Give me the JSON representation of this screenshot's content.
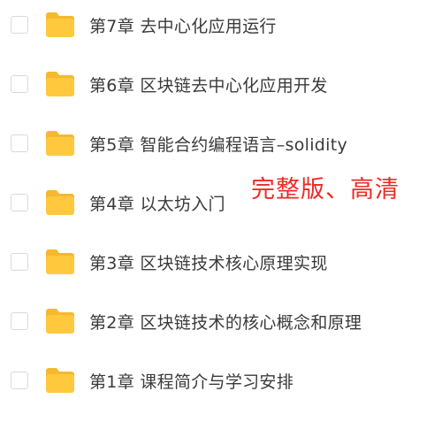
{
  "items": [
    {
      "label": "第7章  去中心化应用运行"
    },
    {
      "label": "第6章  区块链去中心化应用开发"
    },
    {
      "label": "第5章  智能合约编程语言–solidity"
    },
    {
      "label": "第4章  以太坊入门"
    },
    {
      "label": "第3章  区块链技术核心原理实现"
    },
    {
      "label": "第2章  区块链技术的核心概念和原理"
    },
    {
      "label": "第1章  课程简介与学习安排"
    }
  ],
  "overlay": {
    "text": "完整版、高清"
  },
  "colors": {
    "folder": "#FFC83D",
    "folder_tab": "#F5B82E",
    "overlay": "#EE2A24",
    "text": "#3A3A3A",
    "checkbox_border": "#D9D9D9"
  },
  "icons": {
    "folder": "folder-icon"
  }
}
